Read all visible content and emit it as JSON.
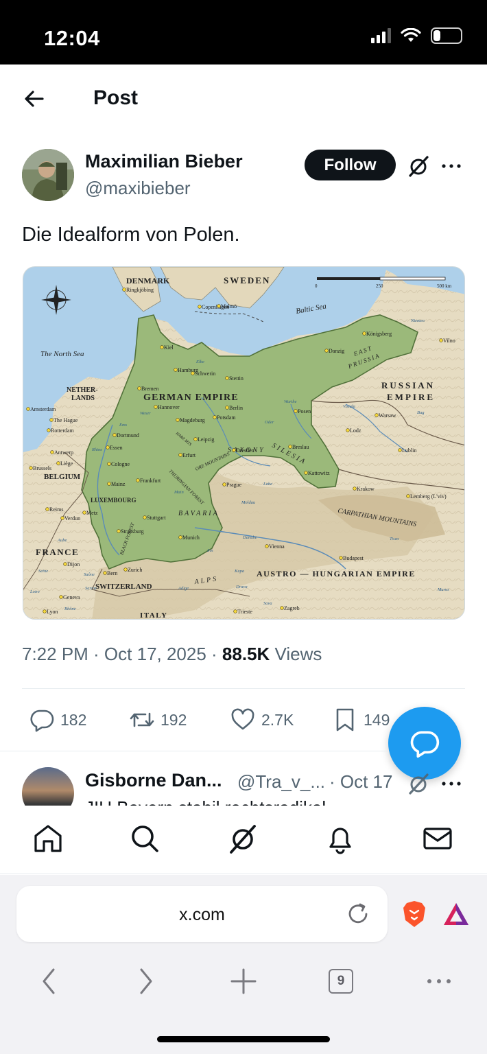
{
  "status_bar": {
    "time": "12:04",
    "battery": "27",
    "battery_level": 0.27
  },
  "header": {
    "title": "Post"
  },
  "post": {
    "author_name": "Maximilian Bieber",
    "author_handle": "@maxibieber",
    "follow_label": "Follow",
    "text": "Die Idealform von Polen.",
    "timestamp": "7:22 PM · Oct 17, 2025 · ",
    "views_count": "88.5K",
    "views_label": " Views",
    "replies": "182",
    "reposts": "192",
    "likes": "2.7K",
    "bookmarks": "149"
  },
  "map": {
    "labels": {
      "denmark": "DENMARK",
      "sweden": "SWEDEN",
      "north_sea": "The North Sea",
      "baltic": "Baltic Sea",
      "german_empire": "GERMAN EMPIRE",
      "russian": "RUSSIAN",
      "empire": "EMPIRE",
      "netherlands_1": "NETHER-",
      "netherlands_2": "LANDS",
      "belgium": "BELGIUM",
      "luxembourg": "LUXEMBOURG",
      "france": "FRANCE",
      "switzerland": "SWITZERLAND",
      "italy": "ITALY",
      "austro": "AUSTRO — HUNGARIAN EMPIRE",
      "carpathian": "CARPATHIAN MOUNTAINS",
      "east_prussia_1": "EAST",
      "east_prussia_2": "PRUSSIA",
      "saxony": "SAXONY",
      "silesia": "SILESIA",
      "bavaria": "BAVARIA",
      "alps": "ALPS",
      "thuringian": "THURINGIAN FOREST",
      "black_forest": "BLACK FOREST",
      "ore_mountains": "ORE MOUNTAINS",
      "harz": "HARZ MTS",
      "scale_0": "0",
      "scale_250": "250",
      "scale_500": "500 km"
    },
    "cities": [
      {
        "name": "Ringkjöbing"
      },
      {
        "name": "Copenhagen"
      },
      {
        "name": "Malmö"
      },
      {
        "name": "Kiel"
      },
      {
        "name": "Hamburg"
      },
      {
        "name": "Schwerin"
      },
      {
        "name": "Stettin"
      },
      {
        "name": "Bremen"
      },
      {
        "name": "Danzig"
      },
      {
        "name": "Königsberg"
      },
      {
        "name": "Niemen"
      },
      {
        "name": "Vilno"
      },
      {
        "name": "Amsterdam"
      },
      {
        "name": "The Hague"
      },
      {
        "name": "Rotterdam"
      },
      {
        "name": "Hannover"
      },
      {
        "name": "Berlin"
      },
      {
        "name": "Potsdam"
      },
      {
        "name": "Magdeburg"
      },
      {
        "name": "Posen"
      },
      {
        "name": "Warsaw"
      },
      {
        "name": "Vistula"
      },
      {
        "name": "Bug"
      },
      {
        "name": "Dortmund"
      },
      {
        "name": "Essen"
      },
      {
        "name": "Leipzig"
      },
      {
        "name": "Lodz"
      },
      {
        "name": "Antwerp"
      },
      {
        "name": "Cologne"
      },
      {
        "name": "Erfurt"
      },
      {
        "name": "Dresden"
      },
      {
        "name": "Breslau"
      },
      {
        "name": "Lublin"
      },
      {
        "name": "Liège"
      },
      {
        "name": "Brussels"
      },
      {
        "name": "Mainz"
      },
      {
        "name": "Frankfurt"
      },
      {
        "name": "Prague"
      },
      {
        "name": "Kattowitz"
      },
      {
        "name": "Krakow"
      },
      {
        "name": "Lemberg (L'viv)"
      },
      {
        "name": "Reims"
      },
      {
        "name": "Verdun"
      },
      {
        "name": "Metz"
      },
      {
        "name": "Stuttgart"
      },
      {
        "name": "Strassburg"
      },
      {
        "name": "Munich"
      },
      {
        "name": "Vienna"
      },
      {
        "name": "Budapest"
      },
      {
        "name": "Dijon"
      },
      {
        "name": "Bern"
      },
      {
        "name": "Zurich"
      },
      {
        "name": "Geneva"
      },
      {
        "name": "Lyon"
      },
      {
        "name": "Trieste"
      },
      {
        "name": "Zagreb"
      },
      {
        "name": "Oder"
      },
      {
        "name": "Warthe"
      },
      {
        "name": "Elbe"
      },
      {
        "name": "Rhine"
      },
      {
        "name": "Main"
      },
      {
        "name": "Danube"
      },
      {
        "name": "Inn"
      },
      {
        "name": "Moldau"
      },
      {
        "name": "Saône"
      },
      {
        "name": "Rhône"
      },
      {
        "name": "Sava"
      },
      {
        "name": "Drava"
      },
      {
        "name": "Tisza"
      },
      {
        "name": "Maros"
      },
      {
        "name": "Weser"
      },
      {
        "name": "Ems"
      },
      {
        "name": "Loire"
      },
      {
        "name": "Seine"
      },
      {
        "name": "Aube"
      },
      {
        "name": "Sarine"
      },
      {
        "name": "Labe"
      },
      {
        "name": "Adige"
      },
      {
        "name": "Kupa"
      }
    ]
  },
  "reply": {
    "name": "Gisborne Dan...",
    "handle": "@Tra_v_...",
    "time": "· Oct 17",
    "text": "JIU Bayern stabil rechtsradikal"
  },
  "browser": {
    "url": "x.com",
    "tab_count": "9"
  }
}
